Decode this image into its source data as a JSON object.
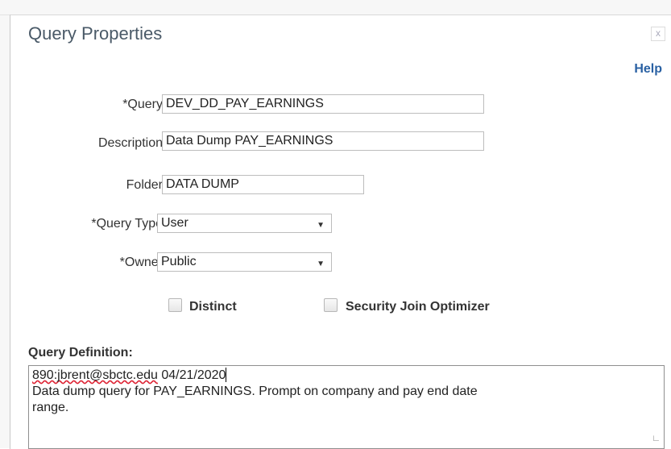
{
  "window": {
    "title": "Query Properties",
    "close_glyph": "x",
    "help_label": "Help"
  },
  "fields": {
    "query": {
      "label": "*Query",
      "value": "DEV_DD_PAY_EARNINGS"
    },
    "description": {
      "label": "Description",
      "value": "Data Dump PAY_EARNINGS"
    },
    "folder": {
      "label": "Folder",
      "value": "DATA DUMP"
    },
    "query_type": {
      "label": "*Query Type",
      "value": "User"
    },
    "owner": {
      "label": "*Owner",
      "value": "Public"
    }
  },
  "options": {
    "distinct": {
      "label": "Distinct",
      "checked": false
    },
    "security_join": {
      "label": "Security Join Optimizer",
      "checked": false
    }
  },
  "definition": {
    "label": "Query Definition:",
    "line1_email": "890:jbrent@sbctc.edu",
    "line1_date": " 04/21/2020",
    "line2": "Data dump query for PAY_EARNINGS.  Prompt on company and pay end date",
    "line3": "range."
  },
  "icons": {
    "dropdown": "dropdown-arrow-icon",
    "close": "close-icon",
    "resize": "resize-grip-icon"
  },
  "colors": {
    "title": "#4a5a68",
    "link": "#2a61a3"
  }
}
